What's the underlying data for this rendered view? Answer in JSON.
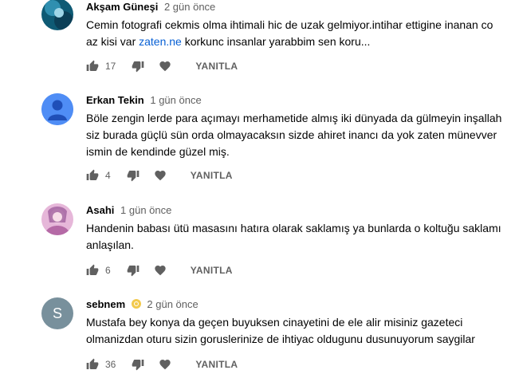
{
  "comments": [
    {
      "author": "Akşam Güneşi",
      "time": "2 gün önce",
      "text_line1": "Cemin fotografi cekmis olma ihtimali hic de uzak gelmiyor.intihar ettigine inanan co",
      "text_line2_before": "az kisi var ",
      "text_line2_link": "zaten.ne",
      "text_line2_after": " korkunc insanlar yarabbim sen koru...",
      "likes": "17",
      "reply_label": "YANITLA",
      "avatar_color": "#1a6b8a"
    },
    {
      "author": "Erkan Tekin",
      "time": "1 gün önce",
      "text_lines": [
        "Böle zengin lerde para açımayı merhametide almış iki dünyada da gülmeyin inşallah",
        "siz burada güçlü sün orda olmayacaksın sizde ahiret inancı da yok zaten münevver",
        "ismin de kendinde güzel miş."
      ],
      "likes": "4",
      "reply_label": "YANITLA",
      "avatar_color": "#4f8df5"
    },
    {
      "author": "Asahi",
      "time": "1 gün önce",
      "text_lines": [
        "Handenin babası ütü masasını hatıra olarak saklamış ya bunlarda o koltuğu saklamı",
        "anlaşılan."
      ],
      "likes": "6",
      "reply_label": "YANITLA",
      "avatar_color": "#c47ab8"
    },
    {
      "author": "sebnem",
      "time": "2 gün önce",
      "avatar_letter": "S",
      "text_lines": [
        "Mustafa bey konya da geçen buyuksen cinayetini de ele alir misiniz gazeteci",
        "olmanizdan oturu sizin goruslerinize de ihtiyac oldugunu dusunuyorum saygilar"
      ],
      "likes": "36",
      "reply_label": "YANITLA",
      "avatar_color": "#78909c"
    }
  ]
}
